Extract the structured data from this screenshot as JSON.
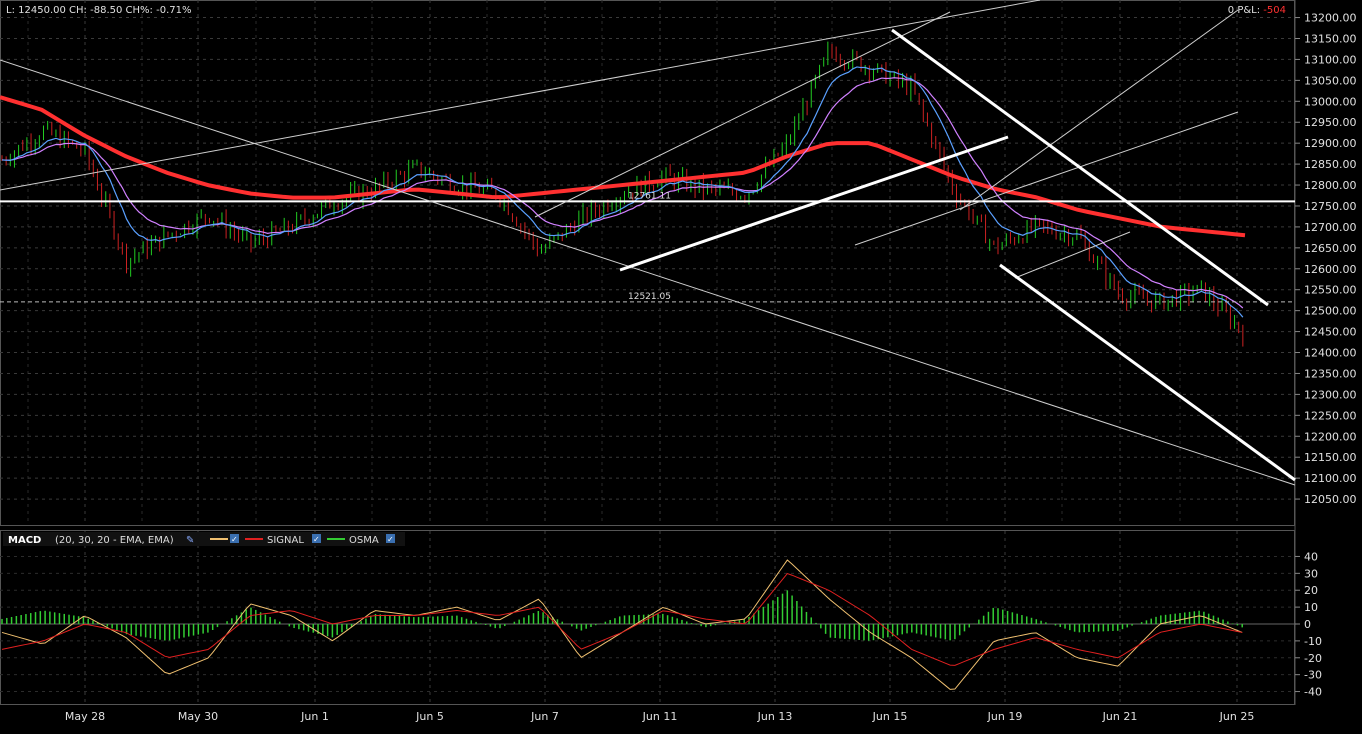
{
  "header": {
    "last_label": "L:",
    "last": "12450.00",
    "ch_label": "CH:",
    "ch": "-88.50",
    "chp_label": "CH%:",
    "chp": "-0.71%",
    "pl_value": "0",
    "pl_label": "P&L:",
    "pl_change": "-504"
  },
  "price_axis": {
    "ticks": [
      13200,
      13150,
      13100,
      13050,
      13000,
      12950,
      12900,
      12850,
      12800,
      12750,
      12700,
      12650,
      12600,
      12550,
      12500,
      12450,
      12400,
      12350,
      12300,
      12250,
      12200,
      12150,
      12100,
      12050
    ],
    "tick_labels": [
      "13200.00",
      "13150.00",
      "13100.00",
      "13050.00",
      "13000.00",
      "12950.00",
      "12900.00",
      "12850.00",
      "12800.00",
      "12750.00",
      "12700.00",
      "12650.00",
      "12600.00",
      "12550.00",
      "12500.00",
      "12450.00",
      "12400.00",
      "12350.00",
      "12300.00",
      "12250.00",
      "12200.00",
      "12150.00",
      "12100.00",
      "12050.00"
    ]
  },
  "date_axis": {
    "labels": [
      "May 28",
      "May 30",
      "Jun 1",
      "Jun 5",
      "Jun 7",
      "Jun 11",
      "Jun 13",
      "Jun 15",
      "Jun 19",
      "Jun 21",
      "Jun 25"
    ]
  },
  "markers": {
    "upper_label": "12761.11",
    "lower_label": "12521.05"
  },
  "macd_legend": {
    "title": "MACD",
    "params": "(20, 30, 20 - EMA, EMA)",
    "signal": "SIGNAL",
    "osma": "OSMA"
  },
  "colors": {
    "background": "#000000",
    "grid": "#3a3a3a",
    "ema_fast": "#5aa0ff",
    "ema_mid": "#d080ff",
    "ma_slow": "#ff3030",
    "macd_line": "#f0c070",
    "signal_line": "#e02020",
    "osma_bars": "#33cc33",
    "candle_up": "#22cc22",
    "candle_down": "#cc2222",
    "loss": "#ff3030"
  },
  "chart_data": [
    {
      "type": "candlestick",
      "ylim": [
        12000,
        13230
      ],
      "x": [
        "May 28",
        "May 30",
        "Jun 1",
        "Jun 5",
        "Jun 7",
        "Jun 11",
        "Jun 13",
        "Jun 15",
        "Jun 19",
        "Jun 21",
        "Jun 25"
      ],
      "close_path": [
        12860,
        12930,
        12880,
        12620,
        12680,
        12730,
        12660,
        12700,
        12760,
        12790,
        12840,
        12800,
        12780,
        12640,
        12720,
        12780,
        12820,
        12790,
        12780,
        12900,
        13120,
        13080,
        13030,
        12790,
        12650,
        12700,
        12680,
        12540,
        12520,
        12550,
        12450
      ],
      "ma_slow": [
        13010,
        12980,
        12920,
        12870,
        12830,
        12800,
        12780,
        12770,
        12770,
        12780,
        12790,
        12780,
        12770,
        12780,
        12790,
        12800,
        12810,
        12820,
        12830,
        12870,
        12900,
        12900,
        12860,
        12820,
        12790,
        12770,
        12740,
        12720,
        12700,
        12690,
        12680
      ],
      "horizontal_levels": [
        12761.11,
        12521.05
      ],
      "current_price": 12450.0,
      "change": -88.5,
      "change_percent": -0.71
    },
    {
      "type": "macd",
      "params": "(20, 30, 20 - EMA, EMA)",
      "ylim": [
        -45,
        45
      ],
      "tick_labels": [
        "40",
        "30",
        "20",
        "10",
        "0",
        "-10",
        "-20",
        "-30",
        "-40"
      ],
      "ticks": [
        40,
        30,
        20,
        10,
        0,
        -10,
        -20,
        -30,
        -40
      ],
      "macd": [
        -5,
        -12,
        5,
        -8,
        -30,
        -20,
        12,
        5,
        -10,
        8,
        5,
        10,
        2,
        15,
        -20,
        -5,
        10,
        0,
        3,
        38,
        15,
        -5,
        -20,
        -40,
        -10,
        -5,
        -20,
        -25,
        0,
        5,
        -5
      ],
      "signal": [
        -15,
        -10,
        0,
        -5,
        -20,
        -15,
        5,
        8,
        0,
        5,
        5,
        8,
        5,
        10,
        -15,
        -5,
        8,
        3,
        0,
        30,
        20,
        5,
        -15,
        -25,
        -15,
        -8,
        -15,
        -20,
        -5,
        0,
        -5
      ],
      "osma": [
        3,
        8,
        4,
        -6,
        -10,
        -5,
        10,
        -2,
        -8,
        6,
        4,
        5,
        -3,
        8,
        -4,
        5,
        6,
        -2,
        3,
        20,
        -8,
        -10,
        -5,
        -10,
        10,
        3,
        -5,
        -4,
        5,
        8,
        -2
      ]
    }
  ]
}
